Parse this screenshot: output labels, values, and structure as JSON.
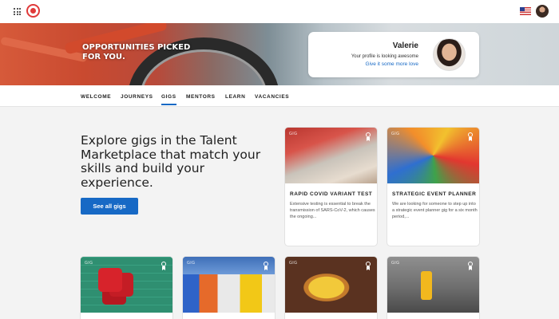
{
  "hero": {
    "headline": "OPPORTUNITIES PICKED FOR YOU."
  },
  "profile": {
    "name": "Valerie",
    "status": "Your profile is looking awesome",
    "link": "Give it some more love"
  },
  "nav": {
    "tabs": [
      {
        "label": "WELCOME"
      },
      {
        "label": "JOURNEYS"
      },
      {
        "label": "GIGS",
        "active": true
      },
      {
        "label": "MENTORS"
      },
      {
        "label": "LEARN"
      },
      {
        "label": "VACANCIES"
      }
    ]
  },
  "intro": {
    "title": "Explore gigs in the Talent Marketplace that match your skills and build your experience.",
    "button": "See all gigs"
  },
  "cards": [
    {
      "tag": "GIG",
      "title": "RAPID COVID VARIANT TEST",
      "description": "Extensive testing is essential to break the transmission of SARS-CoV-2, which causes the ongoing..."
    },
    {
      "tag": "GIG",
      "title": "STRATEGIC EVENT PLANNER",
      "description": "We are looking for someone to step up into a strategic event planner gig for a six month period,..."
    },
    {
      "tag": "GIG"
    },
    {
      "tag": "GIG"
    },
    {
      "tag": "GIG"
    },
    {
      "tag": "GIG"
    }
  ],
  "icons": {
    "apps": "apps-grid-icon",
    "flag": "us-flag-icon",
    "bookmark": "bookmark-ribbon-icon"
  },
  "colors": {
    "accent": "#1769c5",
    "brand": "#e03a3a"
  }
}
